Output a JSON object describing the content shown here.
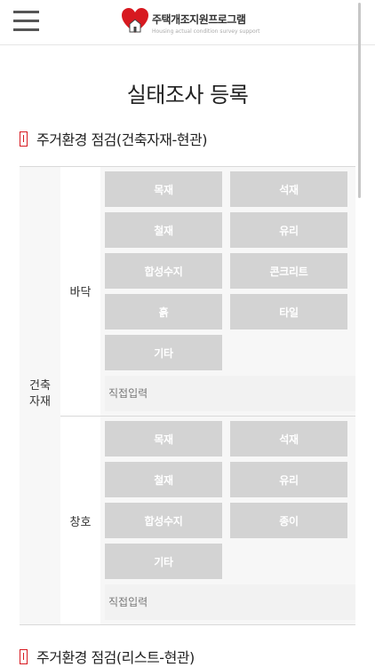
{
  "header": {
    "logo_title": "주택개조지원프로그램",
    "logo_subtitle": "Housing actual condition survey support",
    "menu_icon": "hamburger-menu-icon",
    "logo_icon": "heart-house-icon"
  },
  "page": {
    "title": "실태조사 등록"
  },
  "section1": {
    "title": "주거환경 점검(건축자재-현관)",
    "category": "건축\n자재",
    "floor": {
      "label": "바닥",
      "options": [
        "목재",
        "석재",
        "철재",
        "유리",
        "합성수지",
        "콘크리트",
        "흙",
        "타일",
        "기타"
      ],
      "direct_placeholder": "직접입력"
    },
    "window": {
      "label": "창호",
      "options": [
        "목재",
        "석재",
        "철재",
        "유리",
        "합성수지",
        "종이",
        "기타"
      ],
      "direct_placeholder": "직접입력"
    }
  },
  "section2": {
    "title": "주거환경 점검(리스트-현관)"
  },
  "colors": {
    "accent": "#d71920",
    "option_bg": "#d3d3d3",
    "panel_bg": "#f7f7f7"
  }
}
